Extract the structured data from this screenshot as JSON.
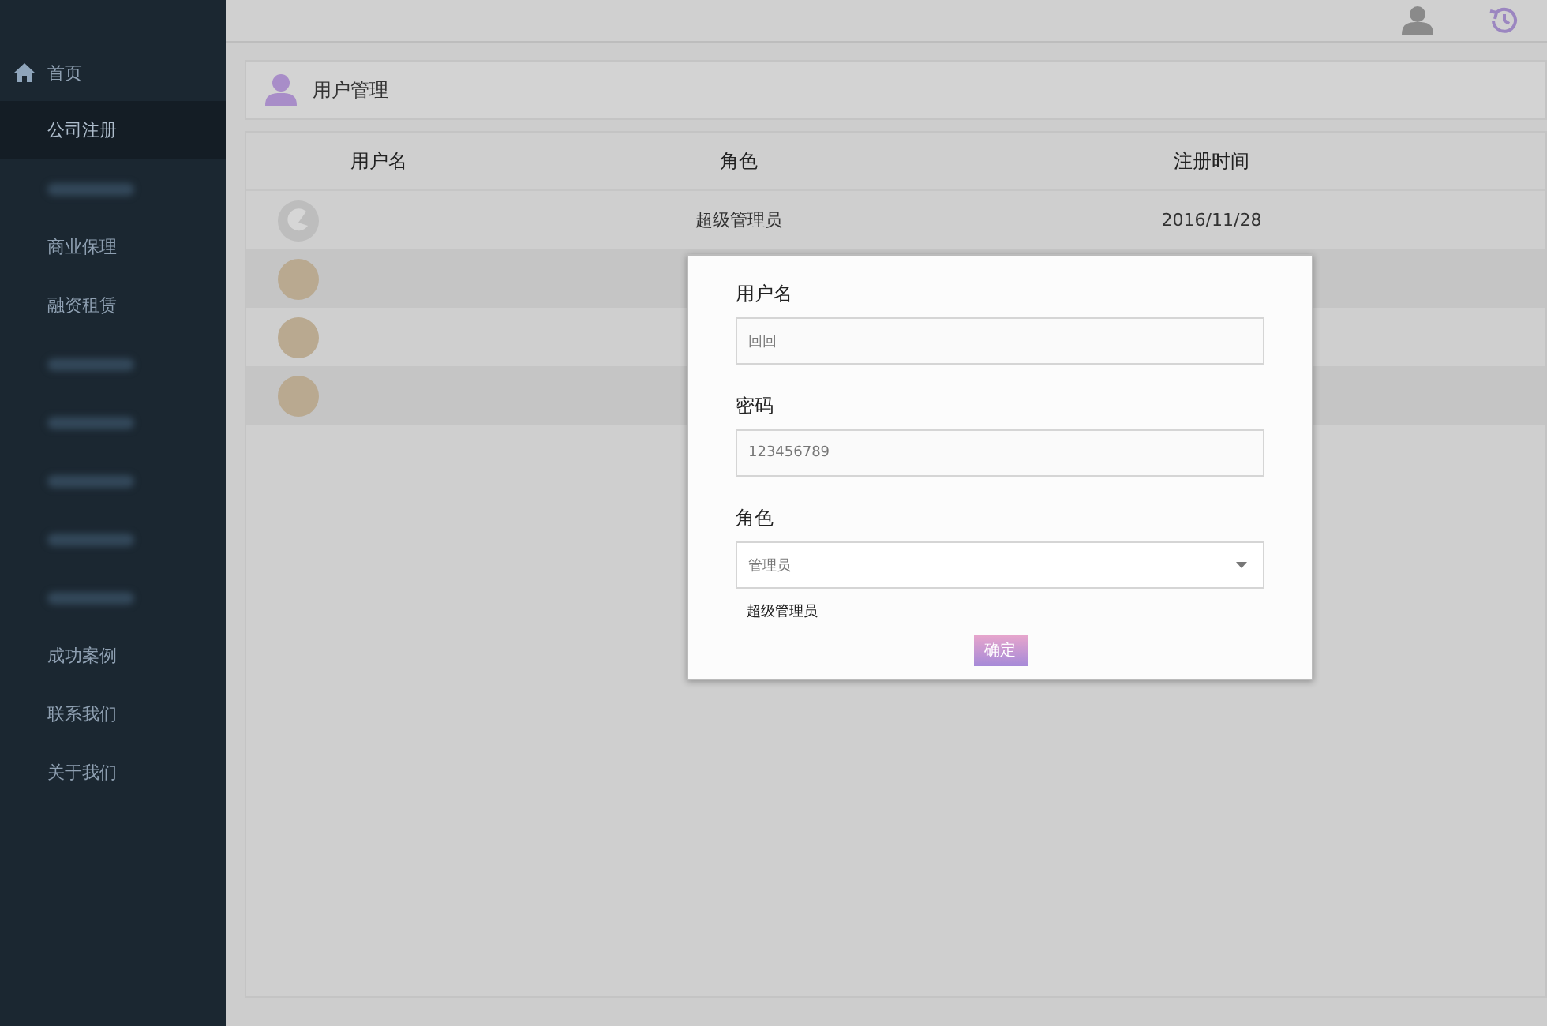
{
  "sidebar": {
    "items": [
      {
        "label": "首页",
        "kind": "home",
        "selected": false
      },
      {
        "label": "公司注册",
        "kind": "link",
        "selected": true
      },
      {
        "kind": "blurred",
        "selected": false
      },
      {
        "label": "商业保理",
        "kind": "link",
        "selected": false
      },
      {
        "label": "融资租赁",
        "kind": "link",
        "selected": false
      },
      {
        "kind": "blurred",
        "selected": false
      },
      {
        "kind": "blurred",
        "selected": false
      },
      {
        "kind": "blurred",
        "selected": false
      },
      {
        "kind": "blurred",
        "selected": false
      },
      {
        "kind": "blurred",
        "selected": false
      },
      {
        "label": "成功案例",
        "kind": "link",
        "selected": false
      },
      {
        "label": "联系我们",
        "kind": "link",
        "selected": false
      },
      {
        "label": "关于我们",
        "kind": "link",
        "selected": false
      }
    ]
  },
  "panel": {
    "title": "用户管理"
  },
  "table": {
    "columns": [
      "用户名",
      "角色",
      "注册时间"
    ],
    "rows": [
      {
        "kind": "logo",
        "role": "超级管理员",
        "date": "2016/11/28"
      },
      {
        "kind": "cartoon"
      },
      {
        "kind": "cartoon"
      },
      {
        "kind": "cartoon"
      }
    ]
  },
  "dialog": {
    "fields": [
      {
        "label": "用户名",
        "kind": "text",
        "value": "回回"
      },
      {
        "label": "密码",
        "kind": "text",
        "value": "123456789"
      },
      {
        "label": "角色",
        "kind": "select",
        "value": "管理员",
        "options": [
          "超级管理员"
        ]
      }
    ],
    "button": "确定"
  }
}
